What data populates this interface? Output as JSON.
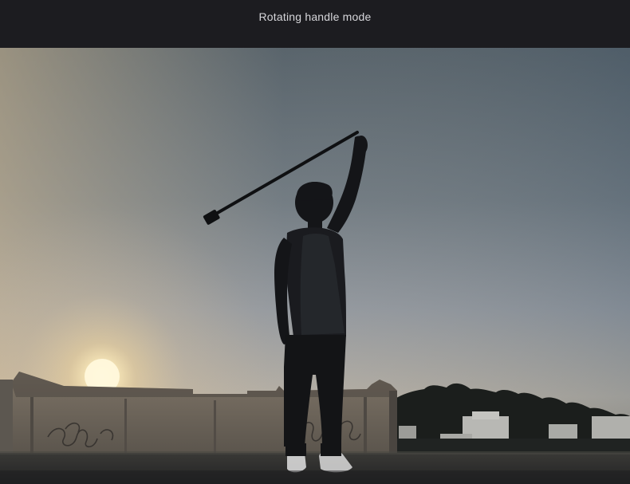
{
  "header": {
    "title": "Rotating handle mode"
  },
  "photo": {
    "subject": "silhouette-person-holding-selfie-stick-at-sunset",
    "colors": {
      "sky_top": "#4c5a64",
      "sky_mid": "#8a929a",
      "sky_low": "#c8b8a0",
      "sun": "#fff3c8",
      "silhouette": "#141518",
      "ground": "#2a2b2c"
    }
  }
}
